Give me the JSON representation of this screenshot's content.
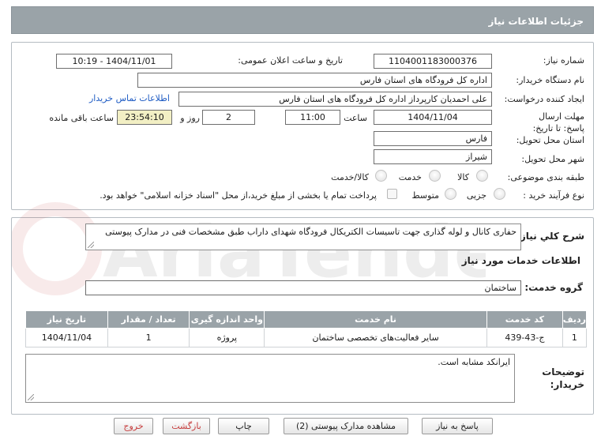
{
  "header": {
    "title": "جزئیات اطلاعات نیاز"
  },
  "form": {
    "need_number_label": "شماره نیاز:",
    "need_number": "1104001183000376",
    "announce_label": "تاریخ و ساعت اعلان عمومی:",
    "announce_value": "1404/11/01 - 10:19",
    "buyer_label": "نام دستگاه خریدار:",
    "buyer_value": "اداره کل فرودگاه های استان فارس",
    "creator_label": "ایجاد کننده درخواست:",
    "creator_value": "علی  احمدیان کارپرداز اداره کل فرودگاه های استان فارس",
    "contact_link": "اطلاعات تماس خریدار",
    "deadline_label": "مهلت ارسال پاسخ: تا تاریخ:",
    "deadline_date": "1404/11/04",
    "time_label": "ساعت",
    "deadline_time": "11:00",
    "days_value": "2",
    "days_label": "روز و",
    "remaining_time": "23:54:10",
    "remaining_label": "ساعت باقی مانده",
    "province_label": "استان محل تحویل:",
    "province_value": "فارس",
    "city_label": "شهر محل تحویل:",
    "city_value": "شیراز",
    "category_label": "طبقه بندی موضوعی:",
    "category_options": [
      "کالا",
      "خدمت",
      "کالا/خدمت"
    ],
    "process_label": "نوع فرآیند خرید :",
    "process_options": [
      "جزیی",
      "متوسط"
    ],
    "payment_text": "پرداخت تمام یا بخشی از مبلغ خرید،از محل \"اسناد خزانه اسلامی\" خواهد بود."
  },
  "details": {
    "summary_label": "شرح کلي نياز:",
    "summary_value": "حفاری کانال و لوله گذاری جهت تاسیسات الکتریکال فرودگاه شهدای داراب طبق مشخصات فنی در مدارک پیوستی",
    "services_heading": "اطلاعات خدمات مورد نیاز",
    "service_group_label": "گروه خدمت:",
    "service_group_value": "ساختمان",
    "table": {
      "headers": [
        "ردیف",
        "کد خدمت",
        "نام خدمت",
        "واحد اندازه گیری",
        "تعداد / مقدار",
        "تاریخ نیاز"
      ],
      "rows": [
        [
          "1",
          "ج-43-439",
          "سایر فعالیت‌های تخصصی ساختمان",
          "پروژه",
          "1",
          "1404/11/04"
        ]
      ]
    },
    "buyer_notes_label": "توضیحات خریدار:",
    "buyer_notes_value": "ایرانکد مشابه است."
  },
  "buttons": {
    "respond": "پاسخ به نیاز",
    "view_docs": "مشاهده مدارک پیوستی (2)",
    "print": "چاپ",
    "back": "بازگشت",
    "exit": "خروج"
  },
  "colors": {
    "header_bg": "#9aa3a8",
    "link": "#1f5cc4",
    "remaining_bg": "#f2efc4",
    "button_red_text": "#c63b3b"
  }
}
